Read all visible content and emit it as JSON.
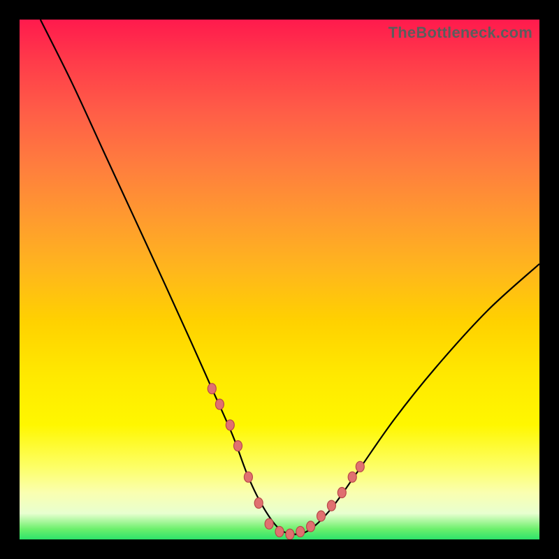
{
  "watermark": "TheBottleneck.com",
  "chart_data": {
    "type": "line",
    "title": "",
    "xlabel": "",
    "ylabel": "",
    "xlim": [
      0,
      100
    ],
    "ylim": [
      0,
      100
    ],
    "series": [
      {
        "name": "bottleneck-curve",
        "x": [
          4,
          10,
          16,
          22,
          28,
          33,
          37,
          41,
          44,
          47,
          50,
          53,
          56,
          60,
          65,
          72,
          80,
          90,
          100
        ],
        "values": [
          100,
          88,
          75,
          62,
          49,
          38,
          29,
          20,
          12,
          6,
          2,
          1,
          2,
          6,
          13,
          23,
          33,
          44,
          53
        ]
      }
    ],
    "markers": {
      "name": "highlight-points",
      "x": [
        37,
        38.5,
        40.5,
        42,
        44,
        46,
        48,
        50,
        52,
        54,
        56,
        58,
        60,
        62,
        64,
        65.5
      ],
      "values": [
        29,
        26,
        22,
        18,
        12,
        7,
        3,
        1.5,
        1,
        1.5,
        2.5,
        4.5,
        6.5,
        9,
        12,
        14
      ]
    },
    "gradient_stops": [
      "#ff1a4d",
      "#ff9a2f",
      "#ffe800",
      "#2de36b"
    ]
  }
}
